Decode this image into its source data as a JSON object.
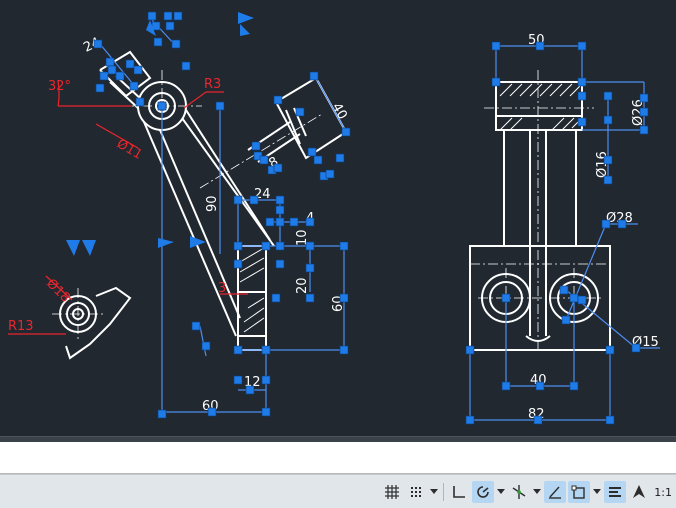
{
  "colors": {
    "canvas_bg": "#212830",
    "geometry": "#ffffff",
    "dimension": "#ffffff",
    "selected_dimension": "#e8262c",
    "grip": "#1e7be8",
    "selection_line": "#4d8ef0",
    "status_active": "#b5d6f3"
  },
  "left_view": {
    "dims": {
      "d32": "32°",
      "r3": "R3",
      "d11": "Ø11",
      "d24_top": "24",
      "d40_angle": "40",
      "d8": "8",
      "d24": "24",
      "d90": "90",
      "d4": "4",
      "d10": "10",
      "d3": "3",
      "d20": "20",
      "d60_v": "60",
      "d12": "12",
      "d60_h": "60",
      "d18": "Ø18",
      "r13": "R13"
    }
  },
  "right_view": {
    "dims": {
      "d50": "50",
      "d26": "Ø26",
      "d16": "Ø16",
      "d28": "Ø28",
      "d15": "Ø15",
      "d40": "40",
      "d82": "82"
    }
  },
  "command_line": {
    "text": ""
  },
  "status_bar": {
    "tools": [
      {
        "icon": "grid-icon",
        "active": false
      },
      {
        "icon": "snap-icon",
        "active": false,
        "dropdown": true
      },
      {
        "icon": "ortho-icon",
        "active": false
      },
      {
        "icon": "polar-icon",
        "active": true,
        "dropdown": true
      },
      {
        "icon": "isodraft-icon",
        "active": false,
        "dropdown": true
      },
      {
        "icon": "object-track-icon",
        "active": true,
        "dropdown": true
      },
      {
        "icon": "osnap-icon",
        "active": true,
        "dropdown": true
      },
      {
        "icon": "lineweight-icon",
        "active": true
      },
      {
        "icon": "annotation-icon",
        "active": false
      }
    ],
    "scale": "1:1"
  }
}
